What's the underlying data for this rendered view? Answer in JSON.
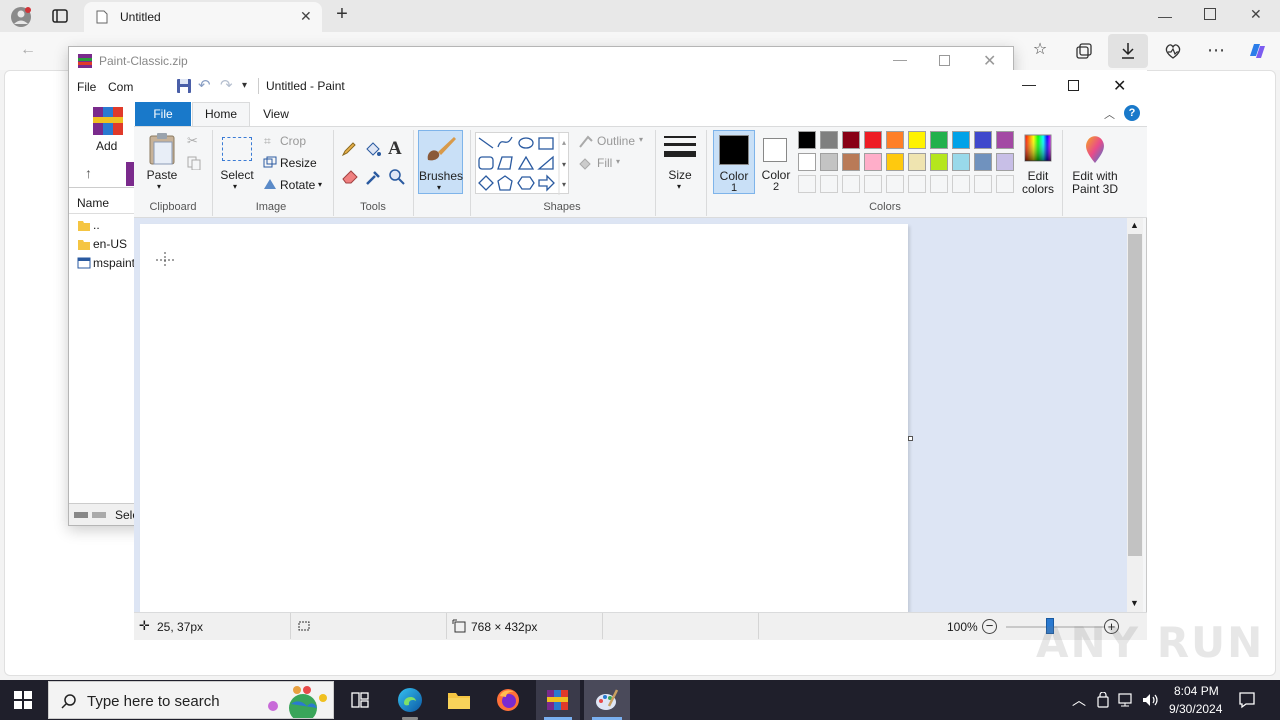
{
  "edge": {
    "tab_title": "Untitled",
    "icons": [
      "profile-icon",
      "tab-actions-icon",
      "new-tab-icon",
      "back-icon",
      "favorites-icon",
      "collections-icon",
      "downloads-icon",
      "browser-essentials-icon",
      "more-icon",
      "copilot-icon"
    ]
  },
  "winrar": {
    "title": "Paint-Classic.zip",
    "menu": [
      "File",
      "Com"
    ],
    "toolbar_add": "Add",
    "column_name": "Name",
    "files": [
      "..",
      "en-US",
      "mspaint"
    ],
    "status_text": "Sele"
  },
  "paint": {
    "title": "Untitled - Paint",
    "tabs": {
      "file": "File",
      "home": "Home",
      "view": "View"
    },
    "clipboard": {
      "paste": "Paste",
      "label": "Clipboard"
    },
    "image": {
      "select": "Select",
      "crop": "Crop",
      "resize": "Resize",
      "rotate": "Rotate",
      "label": "Image"
    },
    "tools": {
      "label": "Tools"
    },
    "brushes": {
      "label": "Brushes"
    },
    "shapes": {
      "outline": "Outline",
      "fill": "Fill",
      "label": "Shapes"
    },
    "size": {
      "label": "Size"
    },
    "colors": {
      "color1_label": "Color",
      "color1_num": "1",
      "color2_label": "Color",
      "color2_num": "2",
      "edit_label": "Edit",
      "edit_label2": "colors",
      "paint3d_label": "Edit with",
      "paint3d_label2": "Paint 3D",
      "label": "Colors",
      "color1": "#000000",
      "color2": "#ffffff",
      "palette_row1": [
        "#000000",
        "#7f7f7f",
        "#880015",
        "#ed1c24",
        "#ff7f27",
        "#fff200",
        "#22b14c",
        "#00a2e8",
        "#3f48cc",
        "#a349a4"
      ],
      "palette_row2": [
        "#ffffff",
        "#c3c3c3",
        "#b97a57",
        "#ffaec9",
        "#ffc90e",
        "#efe4b0",
        "#b5e61d",
        "#99d9ea",
        "#7092be",
        "#c8bfe7"
      ]
    },
    "status": {
      "cursor_pos": "25, 37px",
      "canvas_size": "768 × 432px",
      "zoom": "100%"
    }
  },
  "taskbar": {
    "search_placeholder": "Type here to search",
    "time": "8:04 PM",
    "date": "9/30/2024"
  },
  "watermark": "ANY RUN"
}
